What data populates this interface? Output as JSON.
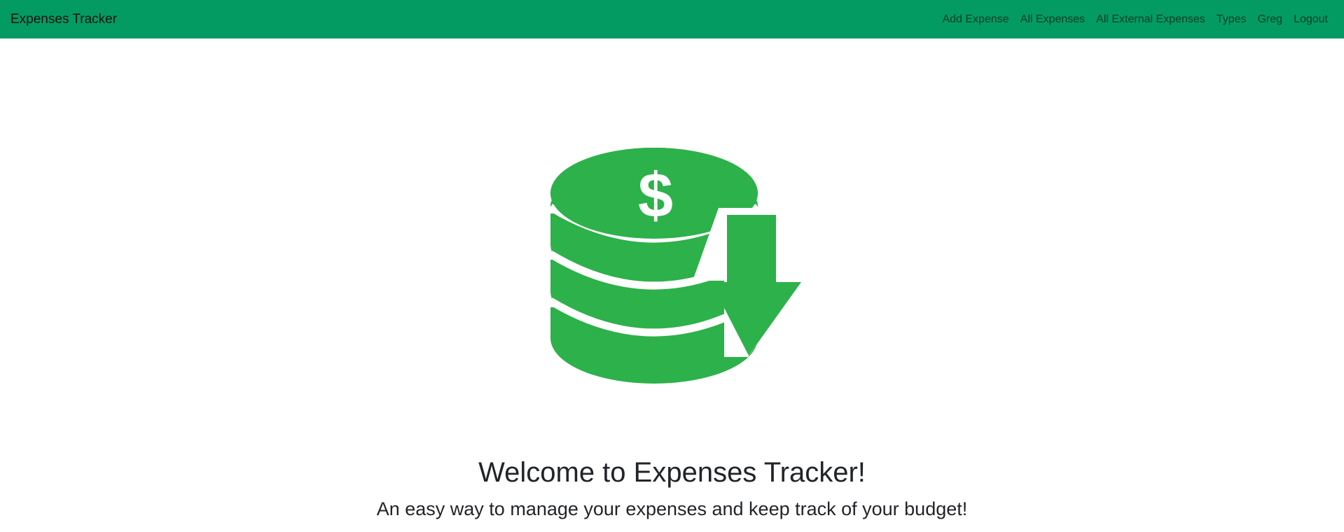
{
  "navbar": {
    "brand": "Expenses Tracker",
    "links": [
      "Add Expense",
      "All Expenses",
      "All External Expenses",
      "Types",
      "Greg",
      "Logout"
    ],
    "background": "#049b63"
  },
  "hero": {
    "logo_icon": "coins-download-icon",
    "logo_color": "#2db14a",
    "title": "Welcome to Expenses Tracker!",
    "subtitle": "An easy way to manage your expenses and keep track of your budget!"
  }
}
